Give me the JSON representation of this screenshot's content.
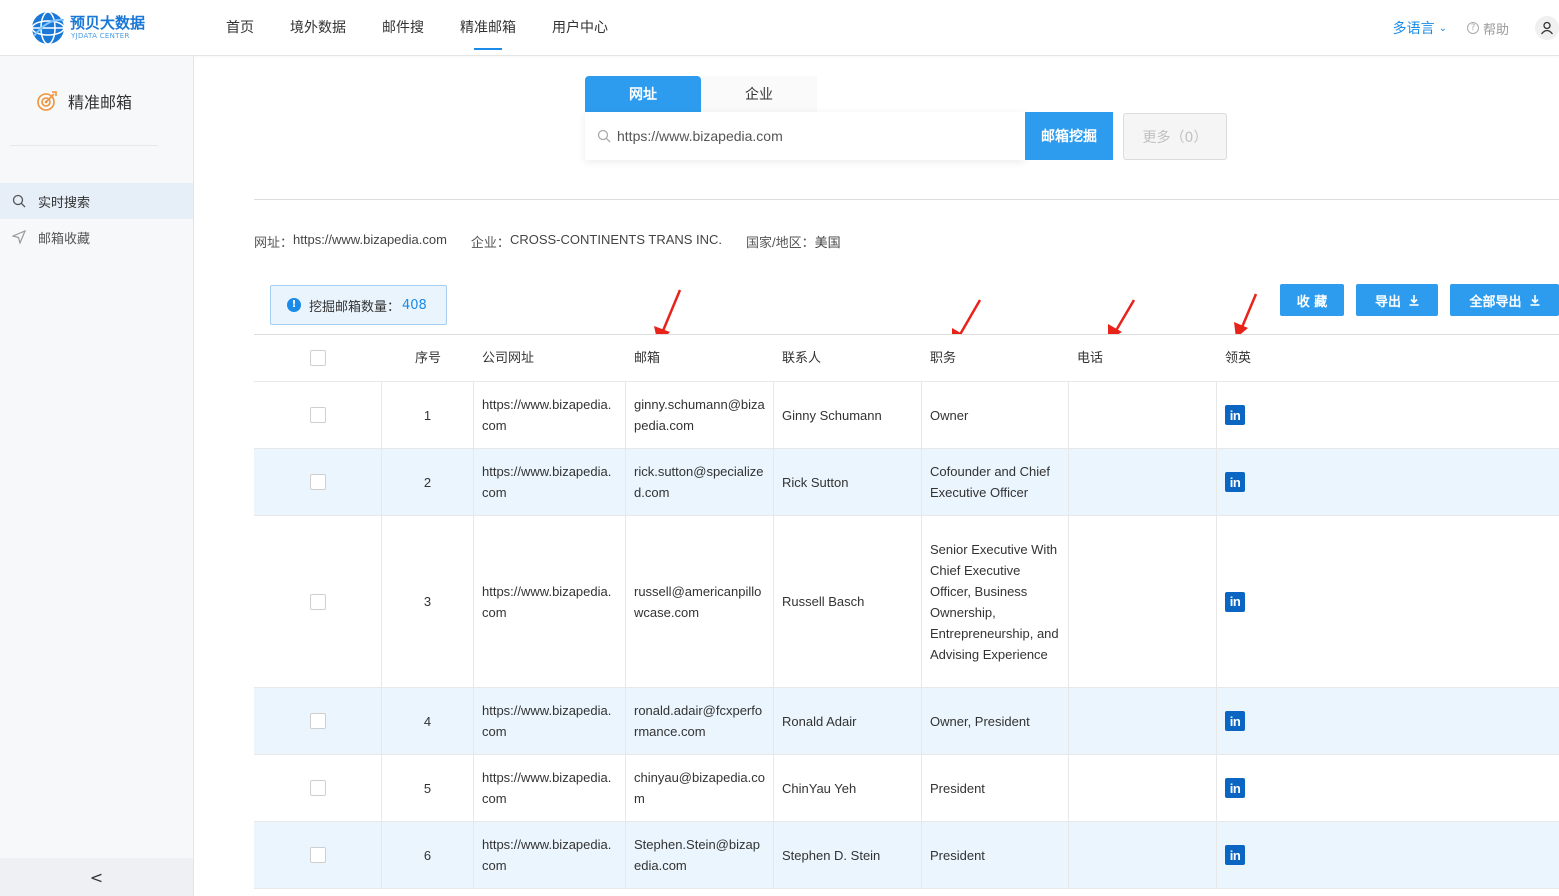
{
  "logo": {
    "cn": "预贝大数据",
    "en": "YJDATA CENTER"
  },
  "nav": [
    {
      "label": "首页",
      "active": false
    },
    {
      "label": "境外数据",
      "active": false
    },
    {
      "label": "邮件搜",
      "active": false
    },
    {
      "label": "精准邮箱",
      "active": true
    },
    {
      "label": "用户中心",
      "active": false
    }
  ],
  "top_right": {
    "language": "多语言",
    "help": "帮助"
  },
  "sidebar": {
    "title": "精准邮箱",
    "items": [
      {
        "label": "实时搜索",
        "icon": "search-icon",
        "active": true
      },
      {
        "label": "邮箱收藏",
        "icon": "send-icon",
        "active": false
      }
    ],
    "collapse": "<"
  },
  "search": {
    "tabs": [
      {
        "label": "网址",
        "active": true
      },
      {
        "label": "企业",
        "active": false
      }
    ],
    "value": "https://www.bizapedia.com",
    "dig_button": "邮箱挖掘",
    "more_button": "更多（0）"
  },
  "info": {
    "url_label": "网址：",
    "url_value": "https://www.bizapedia.com",
    "company_label": "企业：",
    "company_value": "CROSS-CONTINENTS TRANS INC.",
    "country_label": "国家/地区：",
    "country_value": "美国"
  },
  "toolbar": {
    "count_label": "挖掘邮箱数量：",
    "count_value": "408",
    "collect_button": "收 藏",
    "export_button": "导出",
    "export_all_button": "全部导出"
  },
  "table": {
    "columns": [
      "序号",
      "公司网址",
      "邮箱",
      "联系人",
      "职务",
      "电话",
      "领英"
    ],
    "rows": [
      {
        "idx": "1",
        "url": "https://www.bizapedia.com",
        "email": "ginny.schumann@bizapedia.com",
        "name": "Ginny Schumann",
        "title": "Owner",
        "phone": "",
        "linkedin": "in"
      },
      {
        "idx": "2",
        "url": "https://www.bizapedia.com",
        "email": "rick.sutton@specialized.com",
        "name": "Rick Sutton",
        "title": "Cofounder and Chief Executive Officer",
        "phone": "",
        "linkedin": "in"
      },
      {
        "idx": "3",
        "url": "https://www.bizapedia.com",
        "email": "russell@americanpillowcase.com",
        "name": "Russell Basch",
        "title": "Senior Executive With Chief Executive Officer, Business Ownership, Entrepreneurship, and Advising Experience",
        "phone": "",
        "linkedin": "in"
      },
      {
        "idx": "4",
        "url": "https://www.bizapedia.com",
        "email": "ronald.adair@fcxperformance.com",
        "name": "Ronald Adair",
        "title": "Owner, President",
        "phone": "",
        "linkedin": "in"
      },
      {
        "idx": "5",
        "url": "https://www.bizapedia.com",
        "email": "chinyau@bizapedia.com",
        "name": "ChinYau Yeh",
        "title": "President",
        "phone": "",
        "linkedin": "in"
      },
      {
        "idx": "6",
        "url": "https://www.bizapedia.com",
        "email": "Stephen.Stein@bizapedia.com",
        "name": "Stephen D. Stein",
        "title": "President",
        "phone": "",
        "linkedin": "in"
      }
    ]
  },
  "colors": {
    "accent": "#2e9cee",
    "alt_row": "#eaf5fd",
    "arrow": "#e8231a",
    "linkedin": "#0a66c2"
  }
}
